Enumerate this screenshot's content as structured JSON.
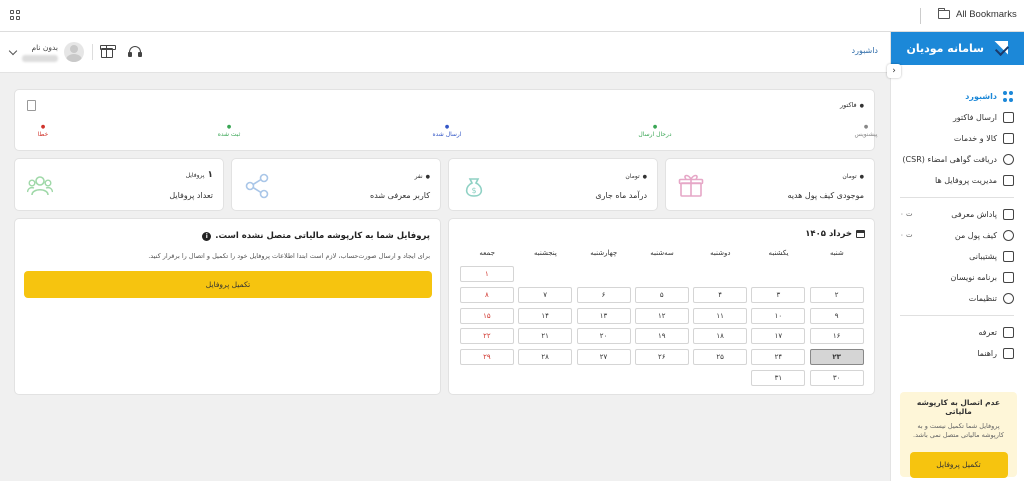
{
  "browser": {
    "bookmarks_label": "All Bookmarks"
  },
  "app": {
    "name": "سامانه مودیان",
    "breadcrumb": "داشبورد"
  },
  "user": {
    "name": "بدون نام"
  },
  "sidebar": {
    "items": [
      {
        "label": "داشبورد",
        "icon": "dashboard-icon",
        "active": true
      },
      {
        "label": "ارسال فاکتور",
        "icon": "invoice-icon"
      },
      {
        "label": "کالا و خدمات",
        "icon": "basket-icon"
      },
      {
        "label": "دریافت گواهی امضاء (CSR)",
        "icon": "certificate-icon"
      },
      {
        "label": "مدیریت پروفایل ها",
        "icon": "users-icon"
      },
      {
        "label": "پاداش معرفی",
        "icon": "gift-icon",
        "side": "۰ ت"
      },
      {
        "label": "کیف پول من",
        "icon": "wallet-icon",
        "side": "۰ ت"
      },
      {
        "label": "پشتیبانی",
        "icon": "chat-icon"
      },
      {
        "label": "برنامه نویسان",
        "icon": "code-icon"
      },
      {
        "label": "تنظیمات",
        "icon": "settings-icon"
      },
      {
        "label": "تعرفه",
        "icon": "coin-icon"
      },
      {
        "label": "راهنما",
        "icon": "help-icon"
      }
    ],
    "promo": {
      "title": "عدم اتصال به کارپوشه مالیاتی",
      "desc": "پروفایل شما تکمیل نیست و به کارپوشه مالیاتی متصل نمی باشد.",
      "button": "تکمیل پروفایل"
    }
  },
  "invoices": {
    "title": "فاکتور",
    "statuses": [
      {
        "label": "پیشنویس",
        "color": "#888888"
      },
      {
        "label": "درحال ارسال",
        "color": "#3aa655"
      },
      {
        "label": "ارسال شده",
        "color": "#3558c7"
      },
      {
        "label": "ثبت شده",
        "color": "#3aa655"
      },
      {
        "label": "خطا",
        "color": "#d0342c"
      }
    ]
  },
  "stats": {
    "gift": {
      "unit": "تومان",
      "label": "موجودی کیف پول هدیه"
    },
    "income": {
      "unit": "تومان",
      "label": "درآمد ماه جاری"
    },
    "referral": {
      "unit": "نفر",
      "label": "کاربر معرفی شده"
    },
    "profiles": {
      "count": "۱",
      "unit": "پروفایل",
      "label": "تعداد پروفایل"
    }
  },
  "profile_notice": {
    "title": "پروفایل شما به کارپوشه مالیاتی متصل نشده است.",
    "desc": "برای ایجاد و ارسال صورت‌حساب، لازم است ابتدا اطلاعات پروفایل خود را تکمیل و اتصال را برقرار کنید.",
    "button": "تکمیل پروفایل"
  },
  "calendar": {
    "title": "خرداد ۱۴۰۵",
    "weekdays": [
      "شنبه",
      "یکشنبه",
      "دوشنبه",
      "سه‌شنبه",
      "چهارشنبه",
      "پنجشنبه",
      "جمعه"
    ],
    "first_weekday_index": 6,
    "today": 23,
    "days": [
      "۱",
      "۲",
      "۳",
      "۴",
      "۵",
      "۶",
      "۷",
      "۸",
      "۹",
      "۱۰",
      "۱۱",
      "۱۲",
      "۱۳",
      "۱۴",
      "۱۵",
      "۱۶",
      "۱۷",
      "۱۸",
      "۱۹",
      "۲۰",
      "۲۱",
      "۲۲",
      "۲۳",
      "۲۴",
      "۲۵",
      "۲۶",
      "۲۷",
      "۲۸",
      "۲۹",
      "۳۰",
      "۳۱"
    ]
  },
  "colors": {
    "accent": "#1c88d8",
    "button": "#f6c40f",
    "friday": "#d0342c"
  }
}
